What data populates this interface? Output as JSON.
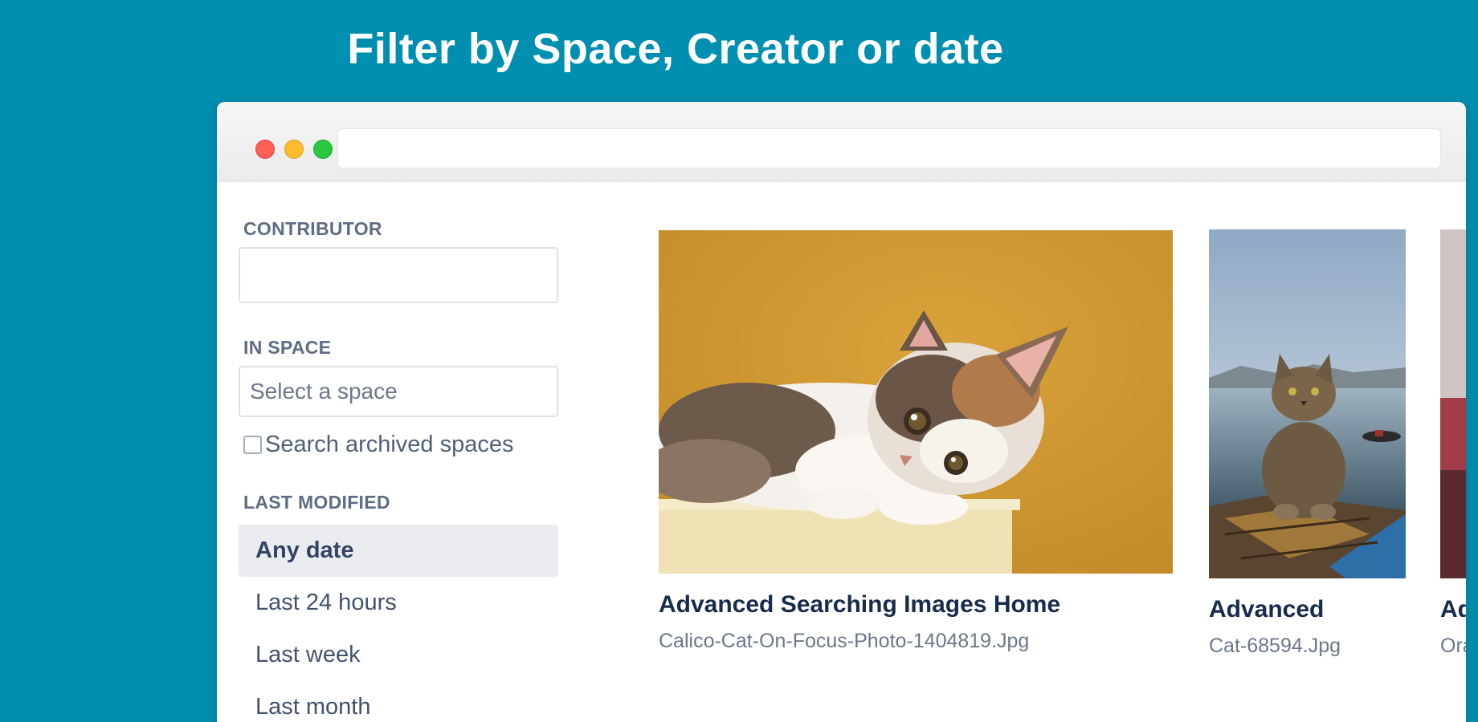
{
  "headline": "Filter by Space, Creator or date",
  "sidebar": {
    "contributor_label": "CONTRIBUTOR",
    "contributor_value": "",
    "space_label": "IN SPACE",
    "space_placeholder": "Select a space",
    "archived_checkbox_label": "Search archived spaces",
    "archived_checked": false,
    "last_modified_label": "LAST MODIFIED",
    "date_options": [
      "Any date",
      "Last 24 hours",
      "Last week",
      "Last month"
    ],
    "selected_date": "Any date"
  },
  "results": [
    {
      "title": "Advanced Searching Images Home",
      "file": "Calico-Cat-On-Focus-Photo-1404819.Jpg",
      "image": "cat-on-yellow-background"
    },
    {
      "title": "Advanced",
      "file": "Cat-68594.Jpg",
      "image": "cat-on-pier-by-water"
    },
    {
      "title": "Ad",
      "file": "Ora",
      "image": "partial-image"
    }
  ],
  "colors": {
    "background": "#008fb0",
    "window": "#ffffff",
    "selected_option": "#ebecf0",
    "label_text": "#5e6c84"
  }
}
